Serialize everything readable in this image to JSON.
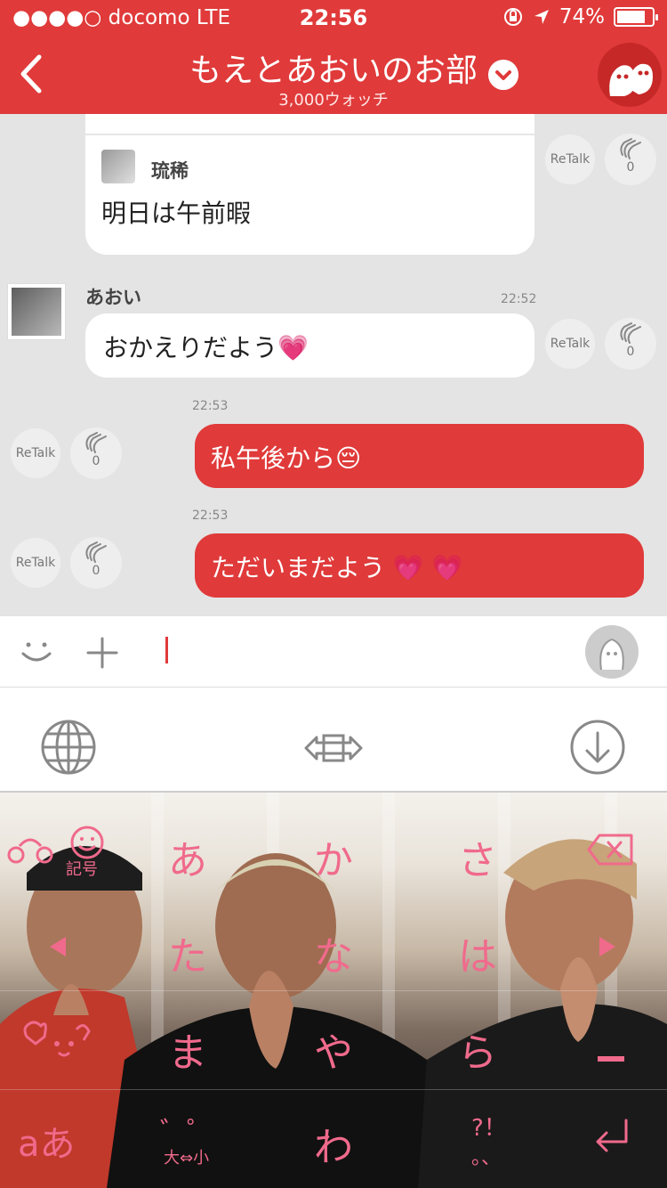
{
  "status_bar": {
    "carrier": "●●●●○ docomo  LTE",
    "time": "22:56",
    "battery": "74%"
  },
  "header": {
    "title": "もえとあおいのお部",
    "watch_count": "3,000ウォッチ"
  },
  "messages": [
    {
      "sender": "琉稀",
      "text": "明日は午前暇",
      "retalk": "ReTalk",
      "claps": "0"
    },
    {
      "sender": "あおい",
      "time": "22:52",
      "text": "おかえりだよう",
      "emoji": "💗",
      "retalk": "ReTalk",
      "claps": "0"
    },
    {
      "time": "22:53",
      "text": "私午後から",
      "emoji": "😔",
      "retalk": "ReTalk",
      "claps": "0"
    },
    {
      "time": "22:53",
      "text": "ただいまだよう",
      "emoji": "💗 💗",
      "retalk": "ReTalk",
      "claps": "0"
    }
  ],
  "keyboard": {
    "row1": [
      "あ",
      "か",
      "さ"
    ],
    "row2": [
      "た",
      "な",
      "は"
    ],
    "row3": [
      "ま",
      "や",
      "ら"
    ],
    "row4": [
      "わ"
    ],
    "kigou": "記号",
    "mode": "aあ",
    "dakuten": "゛゜",
    "size_toggle": "大⇔小",
    "punct": "?！",
    "punct2": "。、"
  },
  "colors": {
    "header_red": "#e03a3a",
    "key_pink": "#f06a8c"
  },
  "icons": {
    "back": "chevron-left-icon",
    "dropdown": "chevron-down-icon",
    "mascot": "ghost-mascot-icon",
    "smile": "smile-icon",
    "plus": "plus-icon",
    "stamp": "stamp-icon",
    "globe": "globe-icon",
    "swap": "swap-icon",
    "hide": "hide-keyboard-icon"
  }
}
